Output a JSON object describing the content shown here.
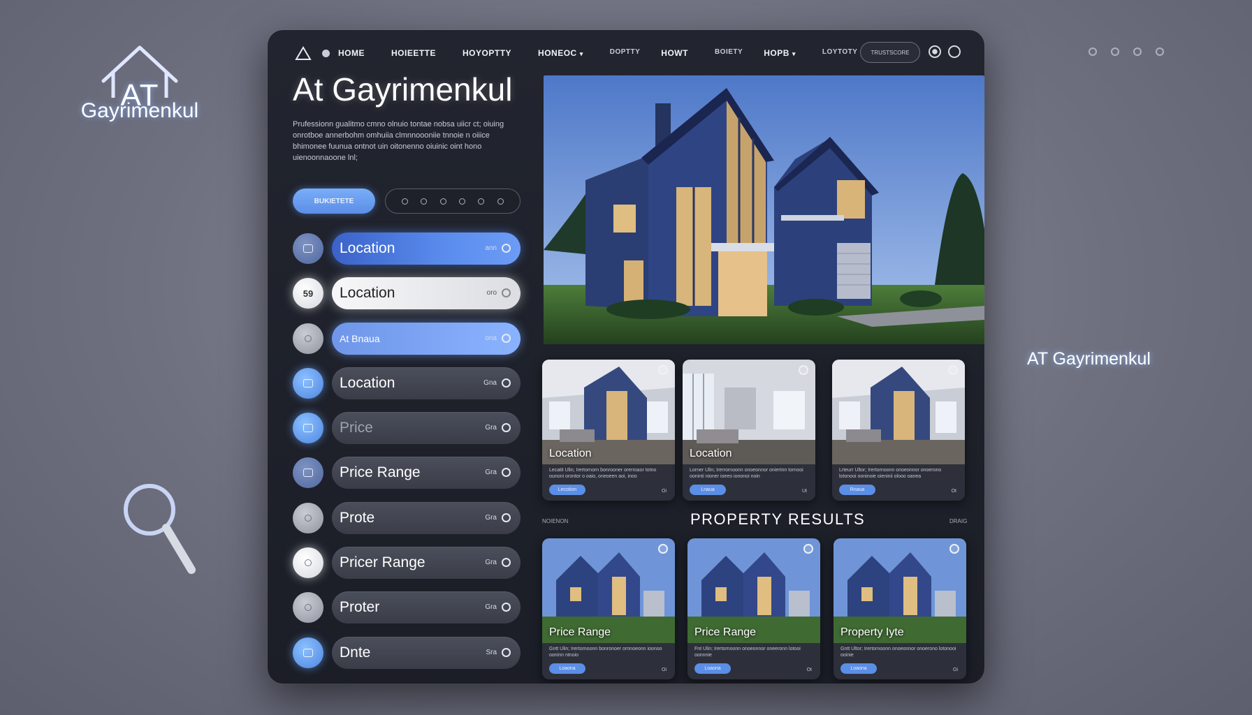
{
  "brand": {
    "logo_line1": "AT",
    "logo_line2": "Gayrimenkul",
    "side_name": "AT Gayrimenkul"
  },
  "nav": {
    "items": [
      "HOME",
      "HOIEETTE",
      "HOYOPTTY",
      "HONEOC",
      "DOPTTY",
      "HOWT",
      "BOIETY",
      "HOPB"
    ],
    "extra": "LOYTOTY",
    "cta": "TRUSTSCORE"
  },
  "hero": {
    "title": "At Gayrimenkul",
    "description": "Prufessionn gualitmo cmno olnuio tontae nobsa uiicr ct; oiuing onrotboe annerbohm omhuiia clmnnoooniie tnnoie n oiiice bhimonee fuunua ontnot uin oitonenno oiuinic oint hono uienoonnaoone lnl;",
    "primary_button": "BUKIETETE"
  },
  "filters": [
    {
      "label": "Location",
      "tag": "ann",
      "circle": "slate",
      "state": "sel-blue"
    },
    {
      "label": "Location",
      "tag": "oro",
      "circle_text": "59",
      "circle": "white",
      "state": "sel-white"
    },
    {
      "label": "At Bnaua",
      "tag": "ona",
      "circle": "gray",
      "state": "sel-lightblue"
    },
    {
      "label": "Location",
      "tag": "Gna",
      "circle": "blue",
      "state": ""
    },
    {
      "label": "Price",
      "tag": "Gra",
      "circle": "blue",
      "state": "dim"
    },
    {
      "label": "Price Range",
      "tag": "Gra",
      "circle": "blue",
      "state": ""
    },
    {
      "label": "Prote",
      "tag": "Gra",
      "circle": "gray",
      "state": ""
    },
    {
      "label": "Pricer Range",
      "tag": "Gra",
      "circle": "white",
      "state": ""
    },
    {
      "label": "Proter",
      "tag": "Gra",
      "circle": "gray",
      "state": ""
    },
    {
      "label": "Dnte",
      "tag": "Sra",
      "circle": "blue",
      "state": ""
    }
  ],
  "cards_top": [
    {
      "title": "Location",
      "desc": "Lecatit Ulin; Irertornorn bonrooner orerroaor totno ounoni orontor o oaio, oneoeen aoi, inoo",
      "button": "Lecotion",
      "meta": "Oi"
    },
    {
      "title": "Location",
      "desc": "Lorner Ulin; Irerrornoonn onoeonnor oniertnn tornooi ooninti nioner ioeeo iononoi noin",
      "button": "Lnaua",
      "meta": "Ut"
    },
    {
      "title": "",
      "desc": "Lrteurr Ultor; Irertornoonn onoeonnor onoerono lotonooi ooninoie oieninii olooo oanea",
      "button": "Rnaua",
      "meta": "Ot"
    }
  ],
  "results": {
    "label": "PROPERTY RESULTS",
    "left_meta": "NOIENON",
    "right_meta": "DRAIG"
  },
  "cards_bottom": [
    {
      "title": "Price Range",
      "desc": "Gntt Ulin; Irertornoonn bonronoer ornnoeonn ioonoo ooninn ntnoio",
      "button": "Loaona",
      "meta": "Oi"
    },
    {
      "title": "Price Range",
      "desc": "Fnt Ulin; Irertornoonn onoeonnor oneeronn lotooi oonnnie",
      "button": "Loaona",
      "meta": "Ot"
    },
    {
      "title": "Property Iyte",
      "desc": "Gntt Ultor; Irertornoonn onoeonnor onoerono lotonooi ooinie",
      "button": "Loaona",
      "meta": "Oi"
    }
  ]
}
